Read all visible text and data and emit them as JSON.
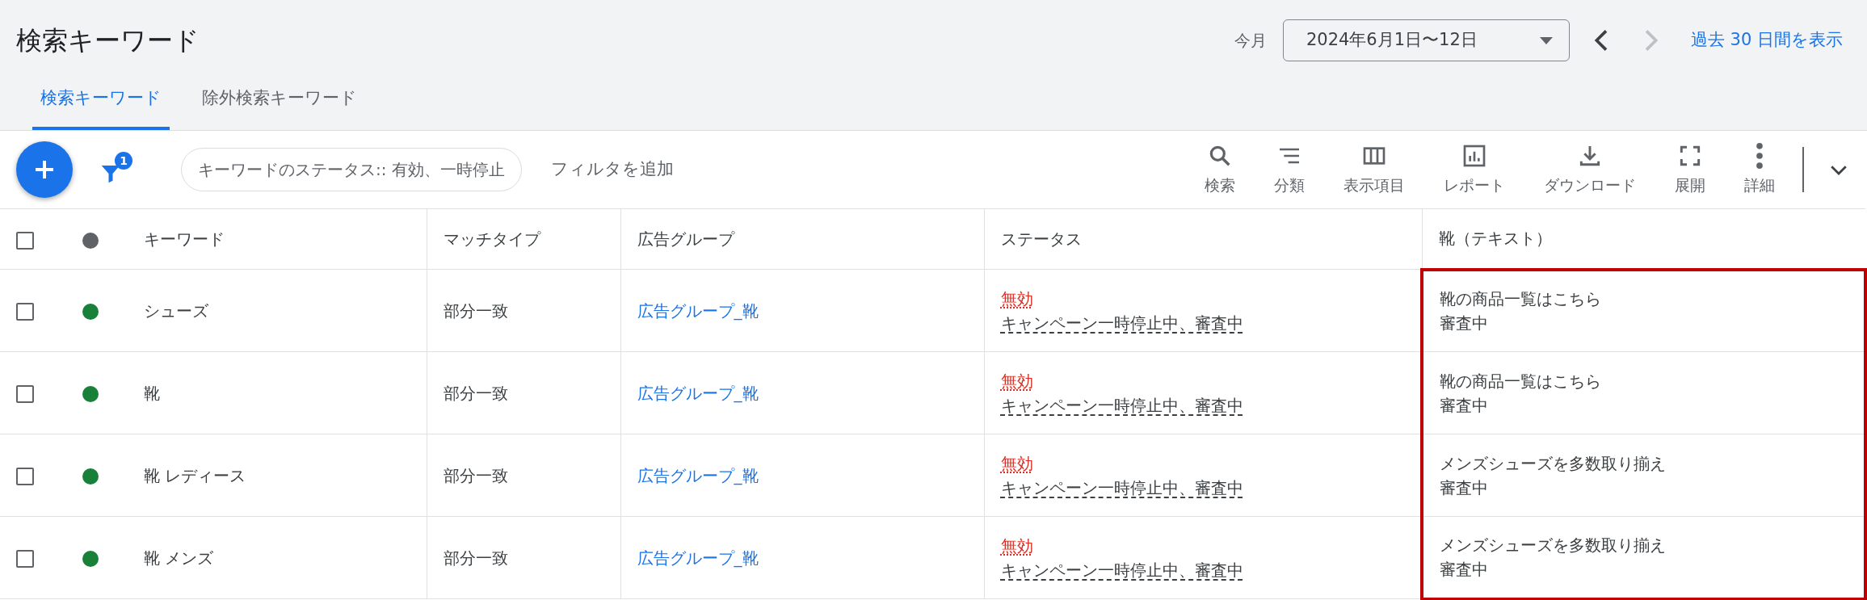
{
  "header": {
    "title": "検索キーワード",
    "period_label": "今月",
    "date_range": "2024年6月1日〜12日",
    "prev_disabled": false,
    "next_disabled": true,
    "link": "過去 30 日間を表示"
  },
  "tabs": [
    {
      "label": "検索キーワード",
      "selected": true
    },
    {
      "label": "除外検索キーワード",
      "selected": false
    }
  ],
  "toolbar": {
    "filter_count": "1",
    "filter_chip": "キーワードのステータス:: 有効、一時停止",
    "add_filter": "フィルタを追加",
    "actions": [
      {
        "kind": "search",
        "label": "検索"
      },
      {
        "kind": "sort",
        "label": "分類"
      },
      {
        "kind": "columns",
        "label": "表示項目"
      },
      {
        "kind": "report",
        "label": "レポート"
      },
      {
        "kind": "download",
        "label": "ダウンロード"
      },
      {
        "kind": "expand",
        "label": "展開"
      },
      {
        "kind": "more",
        "label": "詳細"
      }
    ]
  },
  "table": {
    "select_all_checked": false,
    "columns": [
      {
        "label": "キーワード",
        "highlighted": false
      },
      {
        "label": "マッチタイプ",
        "highlighted": false
      },
      {
        "label": "広告グループ",
        "highlighted": false
      },
      {
        "label": "ステータス",
        "highlighted": false
      },
      {
        "label": "靴（テキスト）",
        "highlighted": true
      }
    ],
    "rows": [
      {
        "checked": false,
        "color": "#188038",
        "keyword": "シューズ",
        "match_type": "部分一致",
        "ad_group": "広告グループ_靴",
        "status": "無効",
        "status_detail": "キャンペーン一時停止中、審査中",
        "text": "靴の商品一覧はこちら",
        "text_status": "審査中"
      },
      {
        "checked": false,
        "color": "#188038",
        "keyword": "靴",
        "match_type": "部分一致",
        "ad_group": "広告グループ_靴",
        "status": "無効",
        "status_detail": "キャンペーン一時停止中、審査中",
        "text": "靴の商品一覧はこちら",
        "text_status": "審査中"
      },
      {
        "checked": false,
        "color": "#188038",
        "keyword": "靴 レディース",
        "match_type": "部分一致",
        "ad_group": "広告グループ_靴",
        "status": "無効",
        "status_detail": "キャンペーン一時停止中、審査中",
        "text": "メンズシューズを多数取り揃え",
        "text_status": "審査中"
      },
      {
        "checked": false,
        "color": "#188038",
        "keyword": "靴 メンズ",
        "match_type": "部分一致",
        "ad_group": "広告グループ_靴",
        "status": "無効",
        "status_detail": "キャンペーン一時停止中、審査中",
        "text": "メンズシューズを多数取り揃え",
        "text_status": "審査中"
      }
    ]
  }
}
